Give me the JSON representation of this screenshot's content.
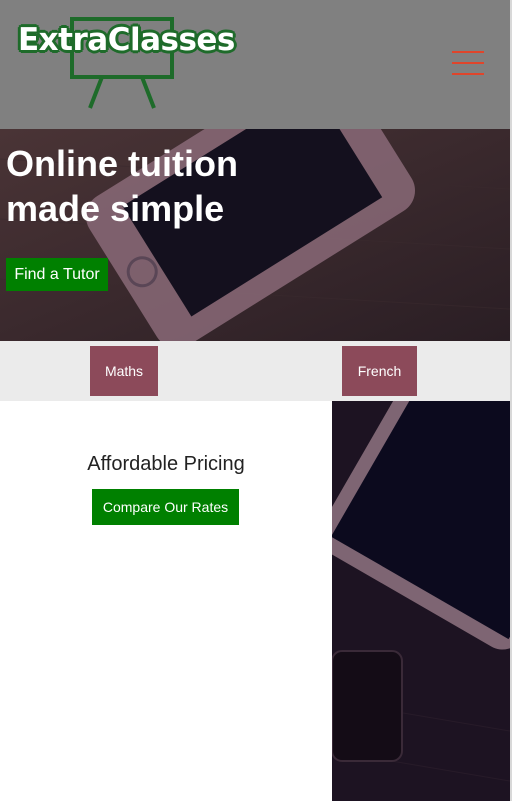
{
  "header": {
    "logo_text": "ExtraClasses",
    "logo_icon": "easel-board-icon",
    "menu_icon": "hamburger-menu-icon"
  },
  "hero": {
    "title_line1": "Online tuition",
    "title_line2": "made simple",
    "cta_label": "Find a Tutor"
  },
  "subjects": {
    "items": [
      {
        "label": "Maths"
      },
      {
        "label": "French"
      }
    ]
  },
  "pricing": {
    "title": "Affordable Pricing",
    "cta_label": "Compare Our Rates"
  },
  "colors": {
    "header_bg": "#808080",
    "brand_green": "#008000",
    "logo_green": "#1e6b2a",
    "menu_accent": "#e0452b",
    "subject_button": "#8c4a5a",
    "strip_bg": "#ebebeb"
  }
}
